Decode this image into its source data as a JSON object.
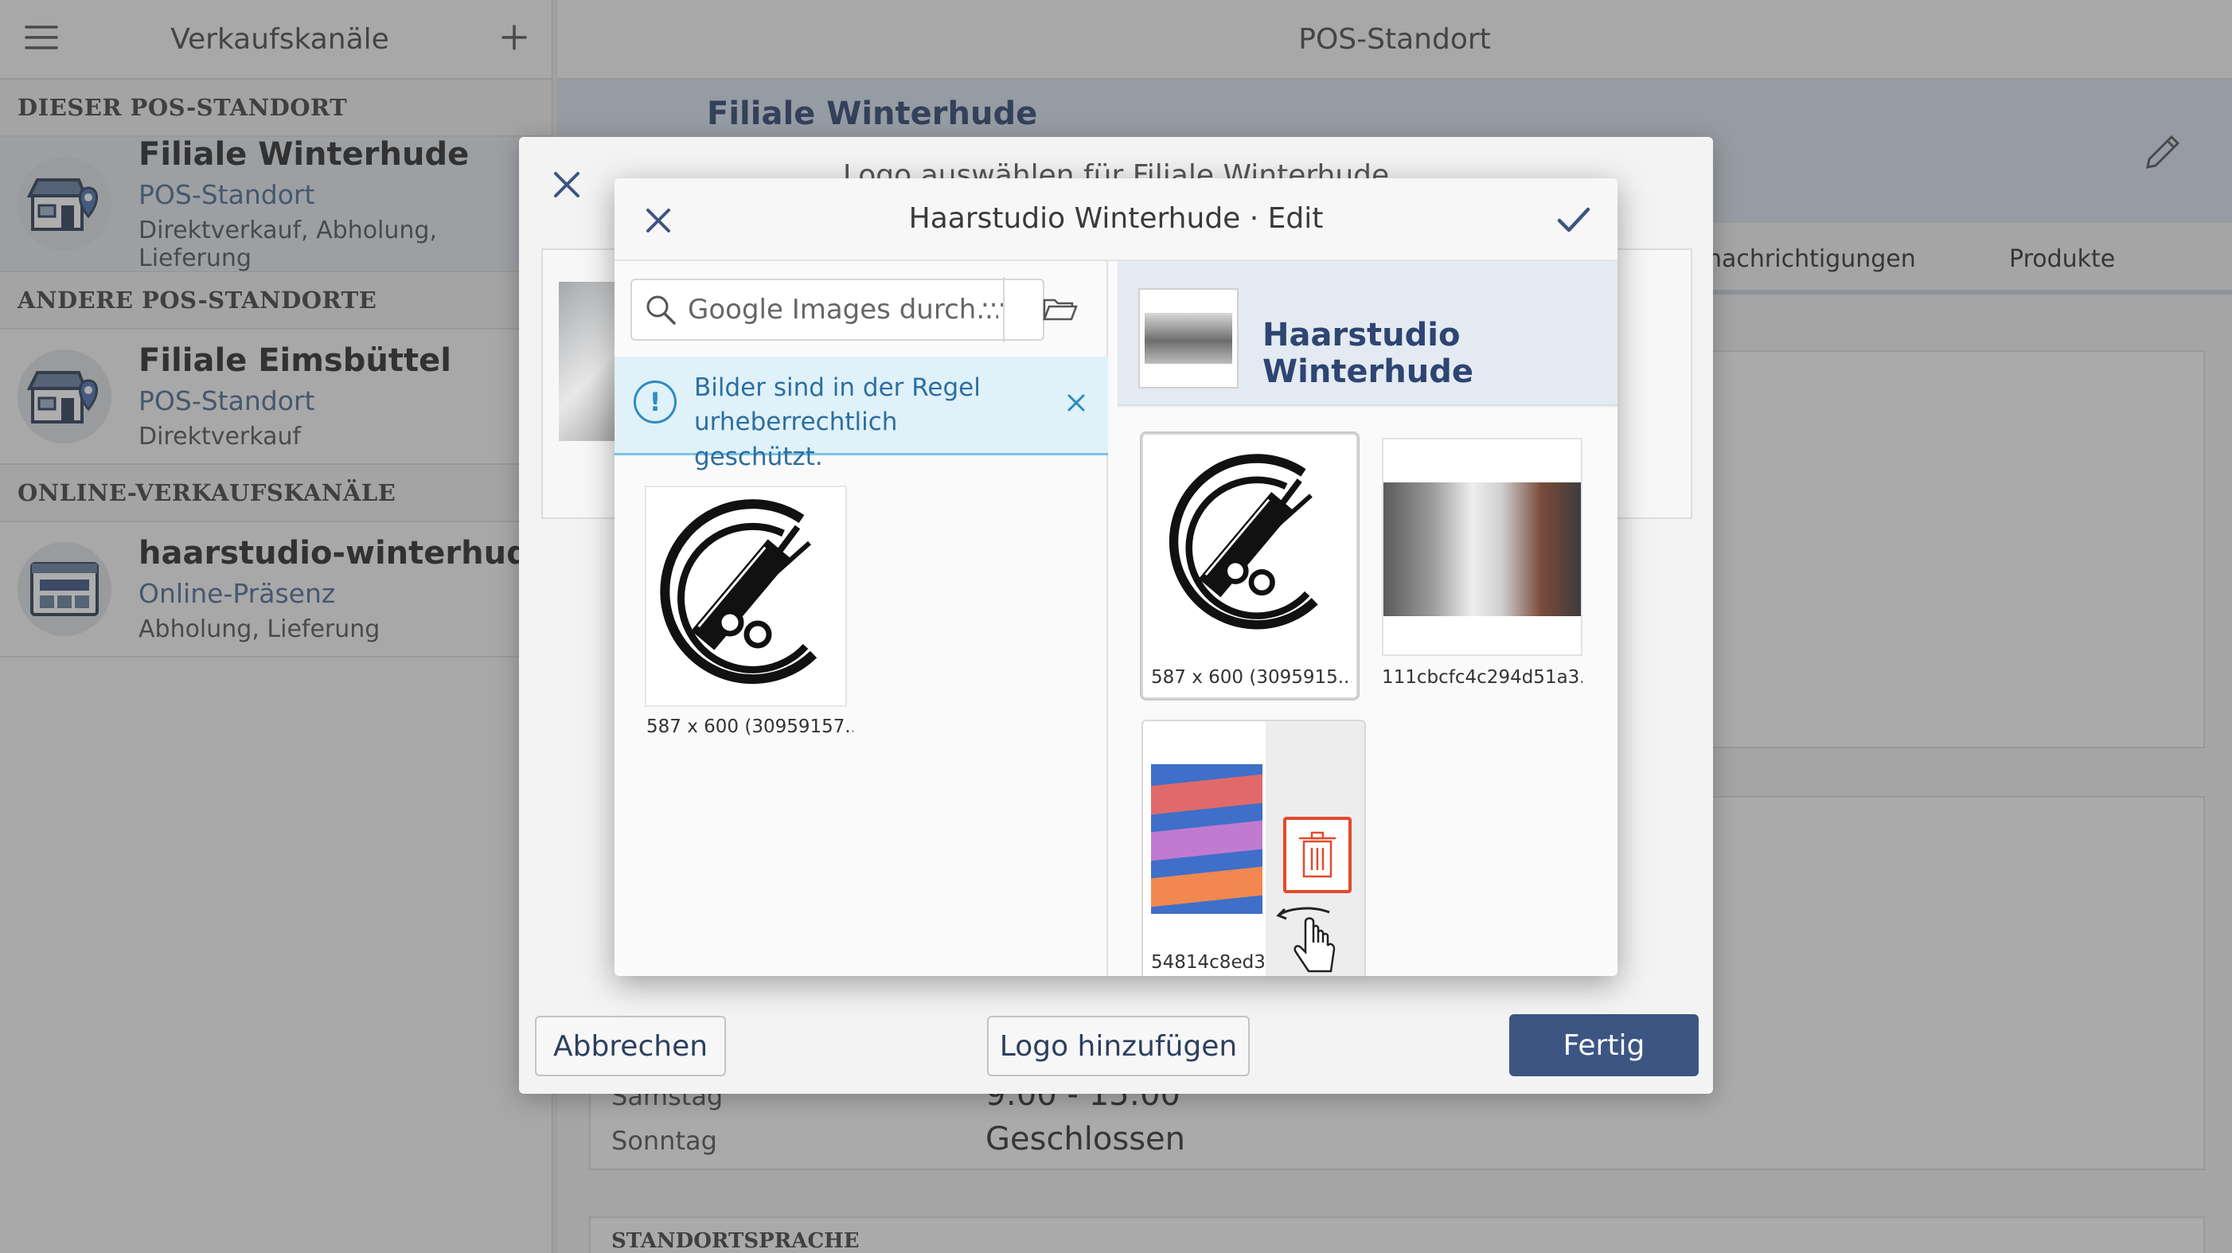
{
  "sidebar": {
    "title": "Verkaufskanäle",
    "sections": [
      {
        "label": "DIESER POS-STANDORT",
        "items": [
          {
            "name": "Filiale Winterhude",
            "type": "POS-Standort",
            "channels": "Direktverkauf, Abholung, Lieferung"
          }
        ]
      },
      {
        "label": "ANDERE POS-STANDORTE",
        "items": [
          {
            "name": "Filiale Eimsbüttel",
            "type": "POS-Standort",
            "channels": "Direktverkauf"
          }
        ]
      },
      {
        "label": "ONLINE-VERKAUFSKANÄLE",
        "items": [
          {
            "name": "haarstudio-winterhude",
            "type": "Online-Präsenz",
            "channels": "Abholung, Lieferung"
          }
        ]
      }
    ]
  },
  "main": {
    "title": "POS-Standort",
    "hero_name": "Filiale Winterhude",
    "tabs": [
      "nachrichtigungen",
      "Produkte"
    ],
    "hours": [
      {
        "day": "Samstag",
        "time": "9:00 - 15:00"
      },
      {
        "day": "Sonntag",
        "time": "Geschlossen"
      }
    ],
    "section_label": "STANDORTSPRACHE"
  },
  "outer_dialog": {
    "title": "Logo auswählen für Filiale Winterhude",
    "cancel_label": "Abbrechen",
    "add_logo_label": "Logo hinzufügen",
    "done_label": "Fertig"
  },
  "inner_dialog": {
    "title": "Haarstudio Winterhude · Edit",
    "search": {
      "placeholder": "Google Images durch...",
      "more": "..."
    },
    "notice": "Bilder sind in der Regel urheberrechtlich geschützt.",
    "results": [
      {
        "caption": "587 x 600 (30959157...",
        "image": "scissors-comb-logo"
      }
    ],
    "selection": {
      "name": "Haarstudio Winterhude",
      "images": [
        {
          "caption": "587 x 600 (3095915...",
          "image": "scissors-comb-logo"
        },
        {
          "caption": "111cbcfc4c294d51a3...",
          "image": "salon-interior-photo"
        },
        {
          "caption": "54814c8ed3",
          "image": "ribbon-banners-drawing"
        }
      ]
    }
  },
  "colors": {
    "accent": "#3d5583",
    "notice_bg": "#dff1f9",
    "notice_text": "#2d6ea0",
    "delete_red": "#e34a2d"
  }
}
